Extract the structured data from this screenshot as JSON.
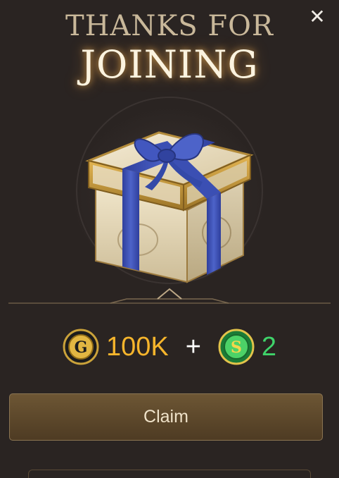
{
  "dialog": {
    "title_line1": "THANKS FOR",
    "title_line2": "JOINING",
    "close_label": "✕",
    "reward": {
      "gold_coin_letter": "G",
      "gold_amount": "100K",
      "plus": "+",
      "sweep_coin_letter": "S",
      "sweep_amount": "2"
    },
    "claim_label": "Claim"
  },
  "icons": [
    "close-icon",
    "gift-box-icon",
    "gold-coin-icon",
    "sweeps-coin-icon"
  ],
  "colors": {
    "background": "#2a2422",
    "gold_text": "#f6b52c",
    "green_text": "#3fd36a",
    "ribbon": "#3c4fb0",
    "button": "#5d4a2e"
  }
}
